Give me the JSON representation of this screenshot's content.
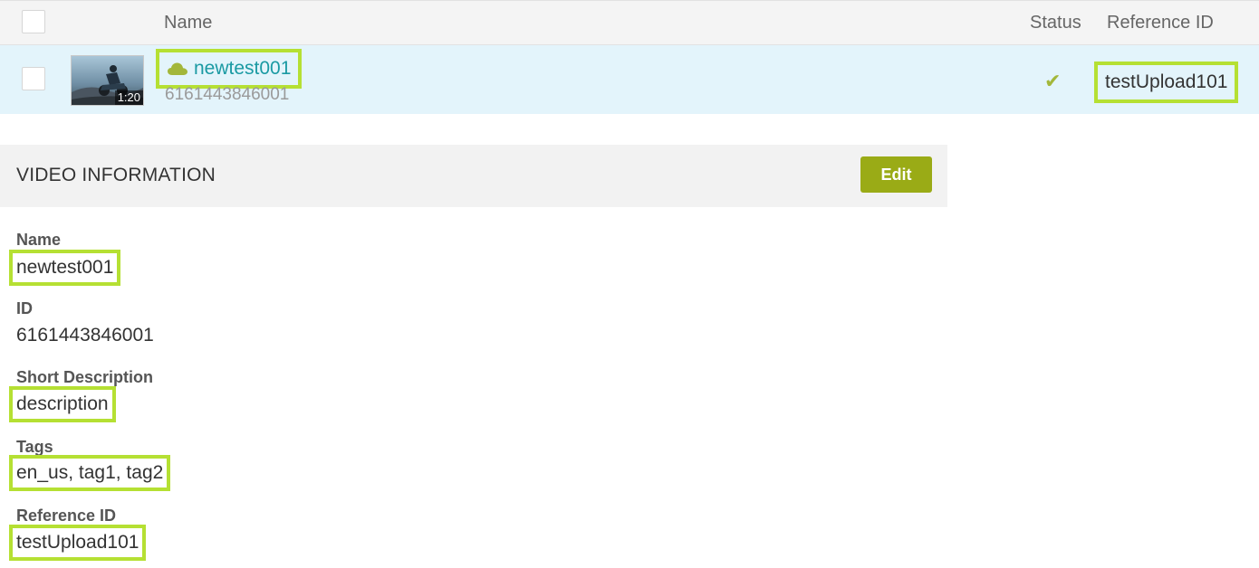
{
  "table": {
    "columns": {
      "name": "Name",
      "status": "Status",
      "reference_id": "Reference ID"
    },
    "rows": [
      {
        "name": "newtest001",
        "id": "6161443846001",
        "duration": "1:20",
        "status_icon": "check-icon",
        "status_glyph": "✔",
        "reference_id": "testUpload101",
        "source_icon": "cloud-icon"
      }
    ]
  },
  "video_info": {
    "title": "VIDEO INFORMATION",
    "edit_label": "Edit",
    "fields": [
      {
        "label": "Name",
        "value": "newtest001"
      },
      {
        "label": "ID",
        "value": "6161443846001"
      },
      {
        "label": "Short Description",
        "value": "description"
      },
      {
        "label": "Tags",
        "value": "en_us, tag1, tag2"
      },
      {
        "label": "Reference ID",
        "value": "testUpload101"
      }
    ]
  },
  "colors": {
    "highlight": "#b5e033",
    "link": "#1a9aa3",
    "accent": "#9aab16",
    "selected_row": "#e3f4fb"
  }
}
